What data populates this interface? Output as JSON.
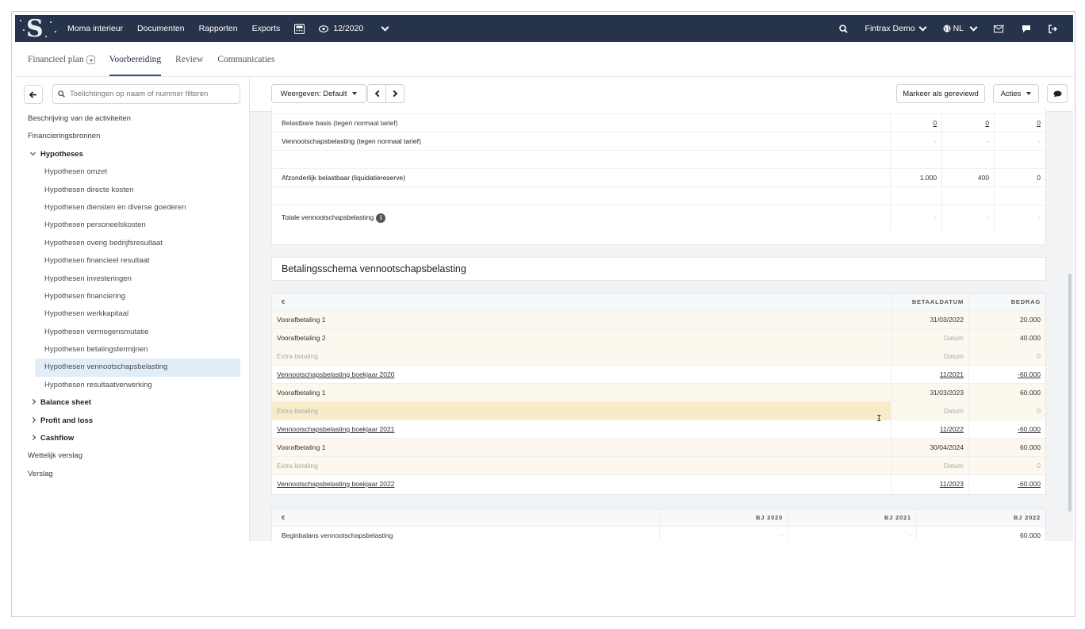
{
  "topbar": {
    "nav": [
      "Moma interieur",
      "Documenten",
      "Rapporten",
      "Exports"
    ],
    "period": "12/2020",
    "account": "Fintrax Demo",
    "language": "NL",
    "icons": [
      "logo-icon",
      "calculator-icon",
      "eye-icon",
      "search-icon",
      "globe-icon",
      "mail-icon",
      "chat-icon",
      "logout-icon"
    ]
  },
  "tabs": [
    "Financieel plan",
    "Voorbereiding",
    "Review",
    "Communicaties"
  ],
  "sidebar": {
    "search_placeholder": "Toelichtingen op naam of nummer filteren",
    "items": [
      {
        "label": "Beschrijving van de activiteiten"
      },
      {
        "label": "Financieringsbronnen"
      },
      {
        "label": "Hypotheses"
      },
      {
        "label": "Hypothesen omzet"
      },
      {
        "label": "Hypothesen directe kosten"
      },
      {
        "label": "Hypothesen diensten en diverse goederen"
      },
      {
        "label": "Hypothesen personeelskosten"
      },
      {
        "label": "Hypothesen overig bedrijfsresultaat"
      },
      {
        "label": "Hypothesen financieel resultaat"
      },
      {
        "label": "Hypothesen investeringen"
      },
      {
        "label": "Hypothesen financiering"
      },
      {
        "label": "Hypothesen werkkapitaal"
      },
      {
        "label": "Hypothesen vermogensmutatie"
      },
      {
        "label": "Hypothesen betalingstermijnen"
      },
      {
        "label": "Hypothesen vennootschapsbelasting"
      },
      {
        "label": "Hypothesen resultaatverwerking"
      },
      {
        "label": "Balance sheet"
      },
      {
        "label": "Profit and loss"
      },
      {
        "label": "Cashflow"
      },
      {
        "label": "Wettelijk verslag"
      },
      {
        "label": "Verslag"
      }
    ]
  },
  "toolbar": {
    "view_label": "Weergeven: Default",
    "review_label": "Markeer als gereviewd",
    "actions_label": "Acties"
  },
  "tax_table": {
    "rows": [
      {
        "label": "Belastbare basis (tegen normaal tarief)",
        "v": [
          "0",
          "0",
          "0"
        ]
      },
      {
        "label": "Vennootschapsbelasting (tegen normaal tarief)",
        "v": [
          "-",
          "-",
          "-"
        ]
      },
      {
        "label": "Afzonderlijk belastbaar (liquidatiereserve)",
        "v": [
          "1.000",
          "400",
          "0"
        ]
      },
      {
        "label": "Totale vennootschapsbelasting",
        "v": [
          "-",
          "-",
          "-"
        ]
      }
    ]
  },
  "schedule": {
    "title": "Betalingsschema vennootschapsbelasting",
    "headers": [
      "€",
      "BETAALDATUM",
      "BEDRAG"
    ],
    "rows": [
      {
        "label": "Voorafbetaling 1",
        "date": "31/03/2022",
        "amount": "20.000"
      },
      {
        "label": "Voorafbetaling 2",
        "date": "Datum",
        "amount": "40.000"
      },
      {
        "label": "Extra betaling",
        "date": "Datum",
        "amount": "0"
      },
      {
        "label": "Vennootschapsbelasting boekjaar 2020",
        "date": "11/2021",
        "amount": "-60.000"
      },
      {
        "label": "Voorafbetaling 1",
        "date": "31/03/2023",
        "amount": "60.000"
      },
      {
        "label": "Extra betaling",
        "date": "Datum",
        "amount": "0"
      },
      {
        "label": "Vennootschapsbelasting boekjaar 2021",
        "date": "11/2022",
        "amount": "-60.000"
      },
      {
        "label": "Voorafbetaling 1",
        "date": "30/04/2024",
        "amount": "60.000"
      },
      {
        "label": "Extra betaling",
        "date": "Datum",
        "amount": "0"
      },
      {
        "label": "Vennootschapsbelasting boekjaar 2022",
        "date": "11/2023",
        "amount": "-60.000"
      }
    ]
  },
  "balance": {
    "headers": [
      "€",
      "BJ 2020",
      "BJ 2021",
      "BJ 2022"
    ],
    "rows": [
      {
        "label": "Beginbalans vennootschapsbelasting",
        "v": [
          "-",
          "-",
          "60.000"
        ]
      }
    ]
  },
  "colors": {
    "topbar": "#26334a",
    "selected": "#e1edf8",
    "cream": "#fdf8ee",
    "highlight": "#f8ebc8"
  }
}
